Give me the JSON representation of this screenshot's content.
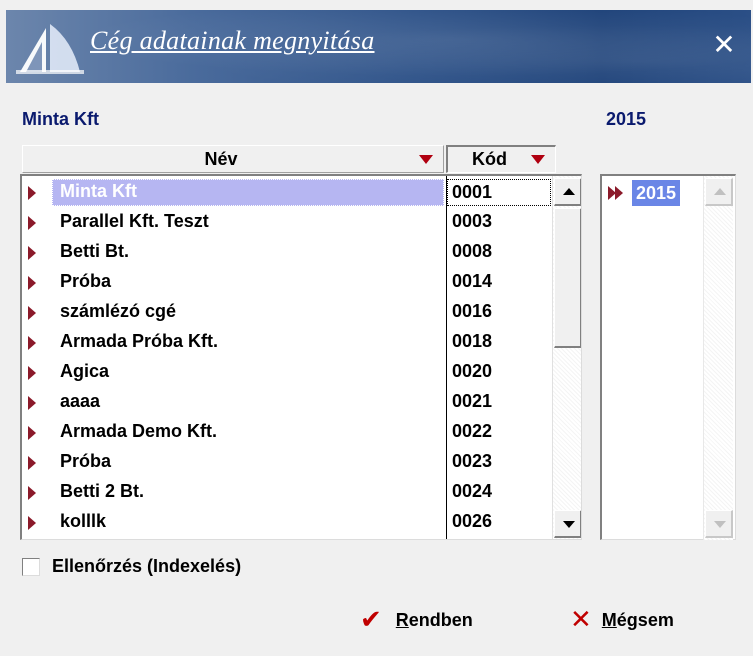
{
  "window": {
    "title": "Cég adatainak megnyitása",
    "close_glyph": "✕"
  },
  "header": {
    "company_name": "Minta Kft",
    "year": "2015"
  },
  "grid": {
    "columns": [
      {
        "label": "Név",
        "sort_indicator": "triangle-down-icon"
      },
      {
        "label": "Kód",
        "sort_indicator": "triangle-down-icon"
      }
    ],
    "selected_index": 0,
    "rows": [
      {
        "name": "Minta Kft",
        "code": "0001"
      },
      {
        "name": "Parallel Kft. Teszt",
        "code": "0003"
      },
      {
        "name": "Betti Bt.",
        "code": "0008"
      },
      {
        "name": "Próba",
        "code": "0014"
      },
      {
        "name": "számlézó cgé",
        "code": "0016"
      },
      {
        "name": "Armada Próba Kft.",
        "code": "0018"
      },
      {
        "name": "Agica",
        "code": "0020"
      },
      {
        "name": "aaaa",
        "code": "0021"
      },
      {
        "name": "Armada Demo Kft.",
        "code": "0022"
      },
      {
        "name": "Próba",
        "code": "0023"
      },
      {
        "name": "Betti 2 Bt.",
        "code": "0024"
      },
      {
        "name": "kolllk",
        "code": "0026"
      }
    ]
  },
  "years": {
    "items": [
      "2015"
    ],
    "selected_index": 0
  },
  "options": {
    "check_label": "Ellenőrzés (Indexelés)",
    "checked": false
  },
  "buttons": {
    "ok_glyph": "✔",
    "ok_mnemonic": "R",
    "ok_rest": "endben",
    "cancel_glyph": "✕",
    "cancel_mnemonic": "M",
    "cancel_rest": "égsem"
  },
  "colors": {
    "marker": "#8b1a2a",
    "selection": "#b6b6f2",
    "year_selection": "#6a86e6",
    "label_blue": "#0a1a6e",
    "accent_red": "#c00000"
  }
}
